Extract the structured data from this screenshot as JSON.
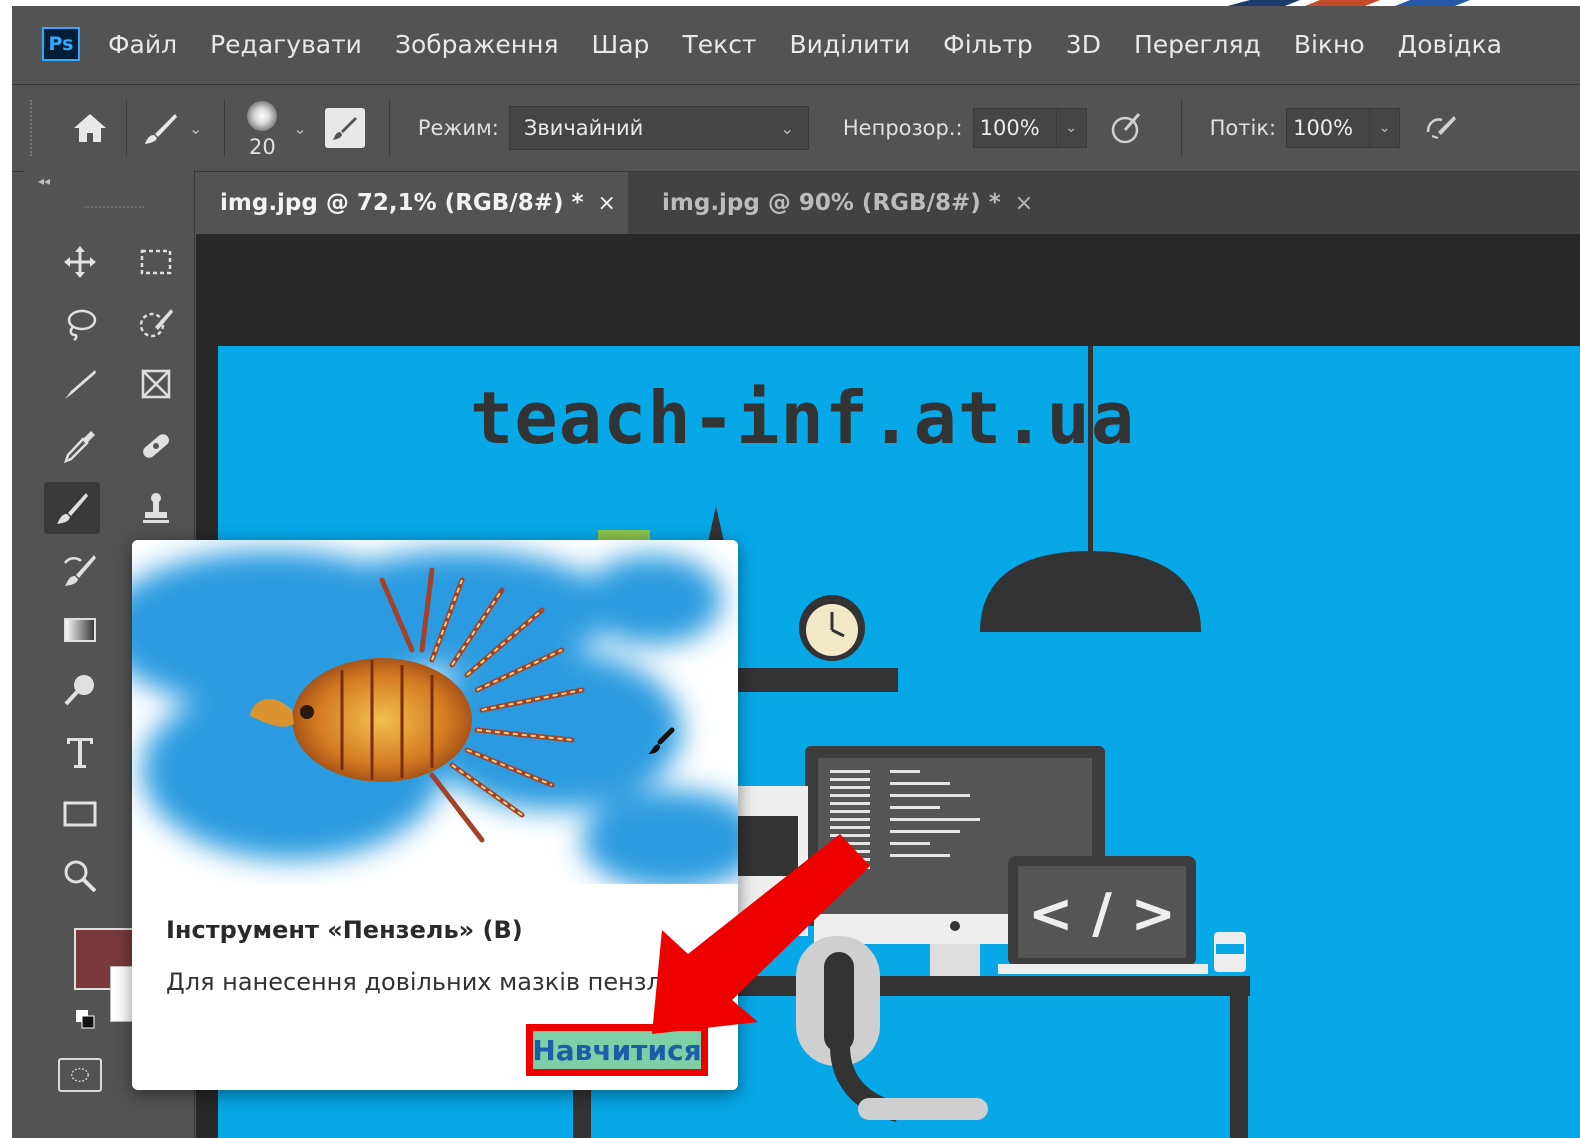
{
  "menu": {
    "logo": "Ps",
    "items": [
      "Файл",
      "Редагувати",
      "Зображення",
      "Шар",
      "Текст",
      "Виділити",
      "Фільтр",
      "3D",
      "Перегляд",
      "Вікно",
      "Довідка"
    ]
  },
  "options": {
    "brush_size": "20",
    "mode_label": "Режим:",
    "mode_value": "Звичайний",
    "opacity_label": "Непрозор.:",
    "opacity_value": "100%",
    "flow_label": "Потік:",
    "flow_value": "100%"
  },
  "tabs": [
    {
      "label": "img.jpg @ 72,1% (RGB/8#) *",
      "close": "×"
    },
    {
      "label": "img.jpg @ 90% (RGB/8#) *",
      "close": "×"
    }
  ],
  "canvas": {
    "site_title": "teach-inf.at.ua",
    "code_symbol": "< / >"
  },
  "tooltip": {
    "title": "Інструмент «Пензель» (B)",
    "description": "Для нанесення довільних мазків пензля",
    "learn_button": "Навчитися"
  },
  "colors": {
    "app_bg": "#535353",
    "panel_dark": "#424242",
    "canvas_bg": "#282828",
    "artwork_bg": "#06a8e8",
    "foreground_color": "#7a3a3b",
    "background_color": "#ffffff",
    "highlight_red": "#ee0000",
    "learn_bg": "#7fcfa6"
  },
  "icons": {
    "logo": "photoshop-logo",
    "home": "home-icon",
    "brush": "brush-icon",
    "airbrush": "airbrush-icon",
    "smoothing": "smoothing-icon",
    "pressure": "pressure-icon"
  }
}
